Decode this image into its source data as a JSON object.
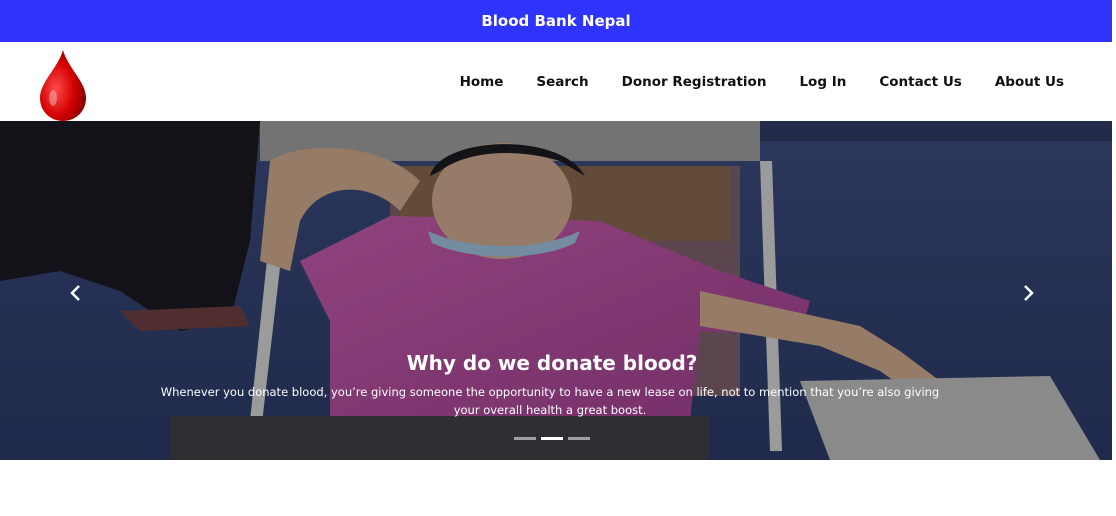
{
  "site": {
    "title": "Blood Bank Nepal"
  },
  "nav": {
    "items": [
      {
        "label": "Home"
      },
      {
        "label": "Search"
      },
      {
        "label": "Donor Registration"
      },
      {
        "label": "Log In"
      },
      {
        "label": "Contact Us"
      },
      {
        "label": "About Us"
      }
    ]
  },
  "hero": {
    "caption_title": "Why do we donate blood?",
    "caption_text": "Whenever you donate blood, you’re giving someone the opportunity to have a new lease on life, not to mention that you’re also giving your overall health a great boost.",
    "slide_count": 3,
    "active_slide": 2
  },
  "colors": {
    "topbar": "#2e34fb",
    "logo": "#d20000"
  },
  "icons": {
    "logo": "blood-drop-icon",
    "prev": "chevron-left-icon",
    "next": "chevron-right-icon"
  }
}
